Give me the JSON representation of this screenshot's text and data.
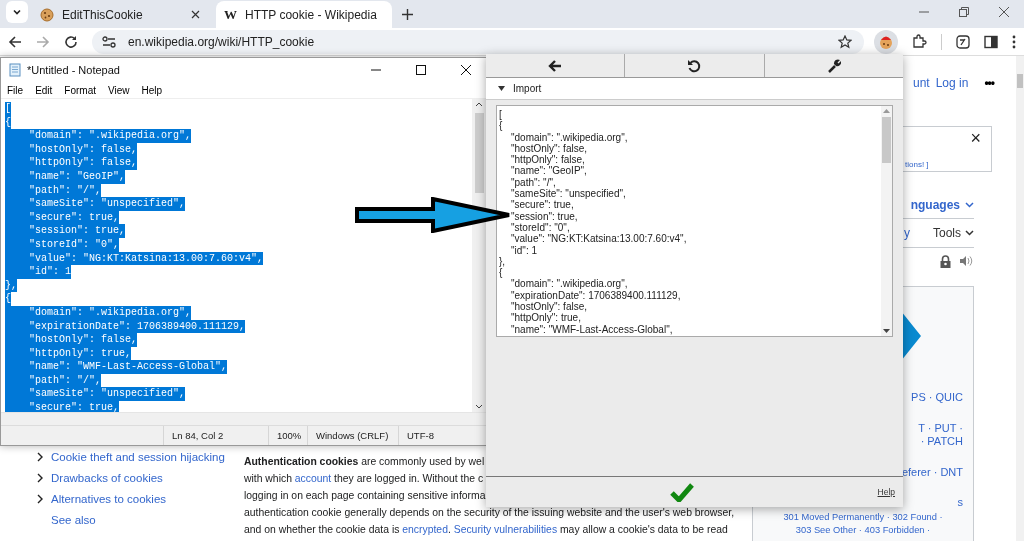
{
  "browser": {
    "tabs": [
      {
        "title": "EditThisCookie",
        "selected": false
      },
      {
        "title": "HTTP cookie - Wikipedia",
        "icon_text": "W",
        "selected": true
      }
    ],
    "address": "en.wikipedia.org/wiki/HTTP_cookie"
  },
  "wiki": {
    "header_links": [
      "unt",
      "Log in"
    ],
    "more": "•••",
    "notice": {
      "text": "tions! ]",
      "close": "×"
    },
    "languages": "nguages",
    "tools_links": [
      "y"
    ],
    "tools": "Tools",
    "infobox": [
      {
        "kind": "cut",
        "lines": [
          "PS · QUIC"
        ]
      },
      {
        "kind": "cut",
        "lines": [
          "T · PUT ·",
          "· PATCH"
        ]
      },
      {
        "kind": "cut",
        "lines": [
          "eferer · DNT"
        ]
      },
      {
        "kind": "cut",
        "lines": [
          "s"
        ]
      },
      {
        "kind": "whole",
        "lines": [
          "301 Moved Permanently · 302 Found ·",
          "303 See Other · 403 Forbidden ·"
        ]
      }
    ],
    "toc": [
      {
        "label": "Cookie theft and session hijacking",
        "kind": "section",
        "expanded": false
      },
      {
        "label": "Drawbacks of cookies",
        "kind": "section",
        "expanded": false
      },
      {
        "label": "Alternatives to cookies",
        "kind": "section",
        "expanded": false
      },
      {
        "label": "See also",
        "kind": "plain"
      }
    ],
    "article": [
      [
        {
          "kind": "text",
          "text": "**Authentication cookies** are commonly used by wel"
        }
      ],
      [
        {
          "kind": "text",
          "text": "with which "
        },
        {
          "kind": "link",
          "text": "account"
        },
        {
          "kind": "text",
          "text": " they are logged in. Without the c"
        }
      ],
      [
        {
          "kind": "text",
          "text": "logging in on each page containing sensitive informa"
        }
      ],
      [
        {
          "kind": "text",
          "text": "authentication cookie generally depends on the security of the issuing website and the user's web browser,"
        }
      ],
      [
        {
          "kind": "text",
          "text": "and on whether the cookie data is "
        },
        {
          "kind": "link",
          "text": "encrypted"
        },
        {
          "kind": "text",
          "text": ". "
        },
        {
          "kind": "link",
          "text": "Security vulnerabilities"
        },
        {
          "kind": "text",
          "text": " may allow a cookie's data to be read"
        }
      ]
    ]
  },
  "notepad": {
    "title": "*Untitled - Notepad",
    "menu": [
      "File",
      "Edit",
      "Format",
      "View",
      "Help"
    ],
    "lines": [
      {
        "text": "[",
        "selected": true
      },
      {
        "text": "{",
        "selected": true
      },
      {
        "text": "    \"domain\": \".wikipedia.org\",",
        "selected": true
      },
      {
        "text": "    \"hostOnly\": false,",
        "selected": true
      },
      {
        "text": "    \"httpOnly\": false,",
        "selected": true
      },
      {
        "text": "    \"name\": \"GeoIP\",",
        "selected": true
      },
      {
        "text": "    \"path\": \"/\",",
        "selected": true
      },
      {
        "text": "    \"sameSite\": \"unspecified\",",
        "selected": true
      },
      {
        "text": "    \"secure\": true,",
        "selected": true
      },
      {
        "text": "    \"session\": true,",
        "selected": true
      },
      {
        "text": "    \"storeId\": \"0\",",
        "selected": true
      },
      {
        "text": "    \"value\": \"NG:KT:Katsina:13.00:7.60:v4\",",
        "selected": true
      },
      {
        "text": "    \"id\": 1",
        "selected": true
      },
      {
        "text": "},",
        "selected": true
      },
      {
        "text": "{",
        "selected": true
      },
      {
        "text": "    \"domain\": \".wikipedia.org\",",
        "selected": true
      },
      {
        "text": "    \"expirationDate\": 1706389400.111129,",
        "selected": true
      },
      {
        "text": "    \"hostOnly\": false,",
        "selected": true
      },
      {
        "text": "    \"httpOnly\": true,",
        "selected": true
      },
      {
        "text": "    \"name\": \"WMF-Last-Access-Global\",",
        "selected": true
      },
      {
        "text": "    \"path\": \"/\",",
        "selected": true
      },
      {
        "text": "    \"sameSite\": \"unspecified\",",
        "selected": true
      },
      {
        "text": "    \"secure\": true,",
        "selected": true
      }
    ],
    "status": [
      "Ln 84, Col 2",
      "100%",
      "Windows (CRLF)",
      "UTF-8"
    ]
  },
  "popup": {
    "section": {
      "label": "Import",
      "expanded": true
    },
    "lines": [
      "[",
      "{",
      "\t\"domain\": \".wikipedia.org\",",
      "\t\"hostOnly\": false,",
      "\t\"httpOnly\": false,",
      "\t\"name\": \"GeoIP\",",
      "\t\"path\": \"/\",",
      "\t\"sameSite\": \"unspecified\",",
      "\t\"secure\": true,",
      "\t\"session\": true,",
      "\t\"storeId\": \"0\",",
      "\t\"value\": \"NG:KT:Katsina:13.00:7.60:v4\",",
      "\t\"id\": 1",
      "},",
      "{",
      "\t\"domain\": \".wikipedia.org\",",
      "\t\"expirationDate\": 1706389400.111129,",
      "\t\"hostOnly\": false,",
      "\t\"httpOnly\": true,",
      "\t\"name\": \"WMF-Last-Access-Global\","
    ],
    "help": "Help"
  }
}
